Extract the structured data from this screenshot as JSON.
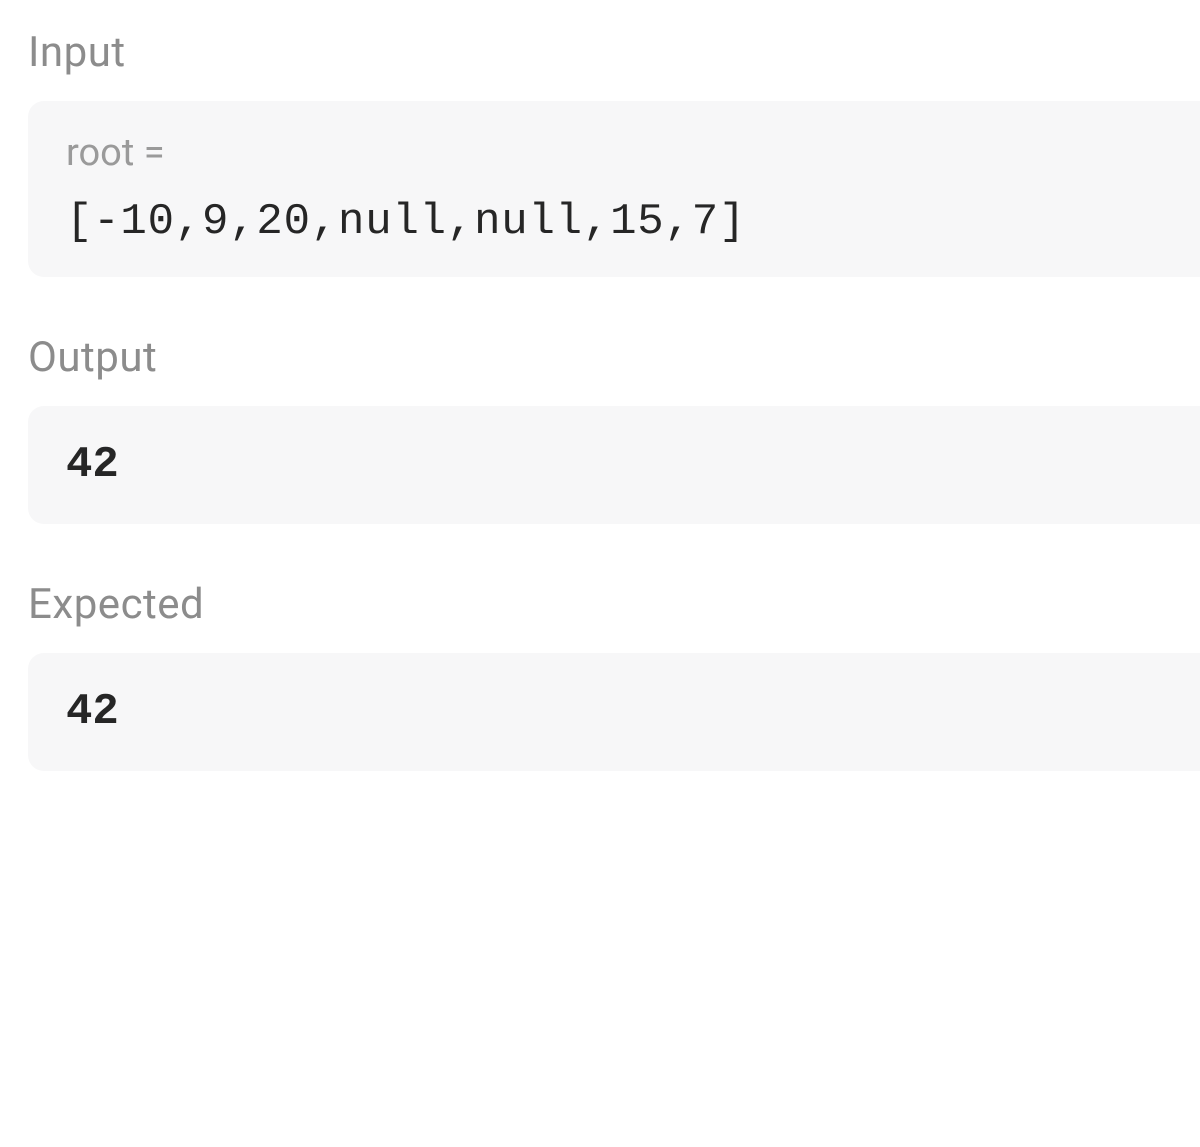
{
  "input": {
    "label": "Input",
    "param_name": "root =",
    "param_value": "[-10,9,20,null,null,15,7]"
  },
  "output": {
    "label": "Output",
    "value": "42"
  },
  "expected": {
    "label": "Expected",
    "value": "42"
  }
}
